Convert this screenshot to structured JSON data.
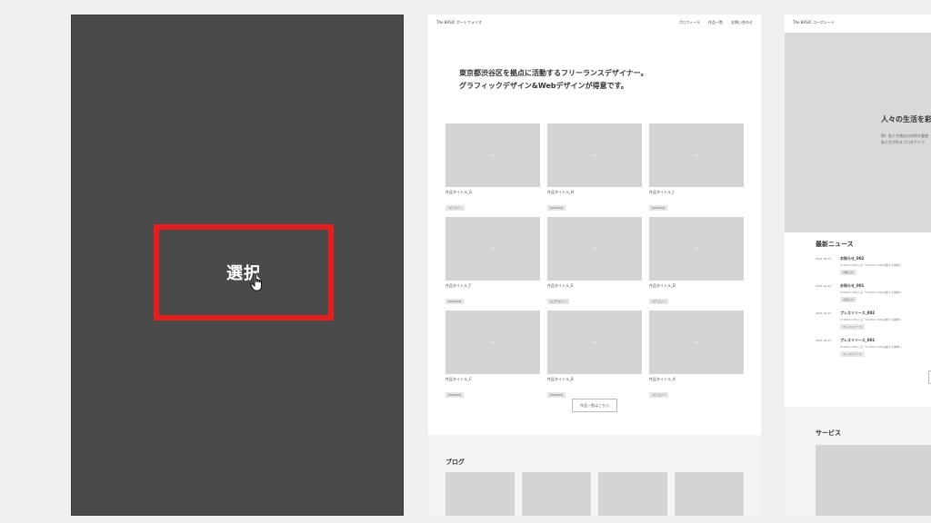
{
  "templates": {
    "selected": {
      "select_label": "選択"
    },
    "portfolio": {
      "brand": "The BASIC ポートフォリオ",
      "nav": [
        "プロフィール",
        "作品一覧",
        "お問い合わせ"
      ],
      "hero_lines": [
        "東京都渋谷区を拠点に活動するフリーランスデザイナー。",
        "グラフィックデザイン&Webデザインが得意です。"
      ],
      "works": [
        {
          "title": "作品タイトル_G",
          "tag": "カテゴリー"
        },
        {
          "title": "作品タイトル_H",
          "tag": "#DESIGN"
        },
        {
          "title": "作品タイトル_I",
          "tag": "#DESIGN"
        },
        {
          "title": "作品タイトル_F",
          "tag": "#DESIGN"
        },
        {
          "title": "作品タイトル_E",
          "tag": "ロゴデザイン"
        },
        {
          "title": "作品タイトル_D",
          "tag": "カテゴリー"
        },
        {
          "title": "作品タイトル_C",
          "tag": "#DESIGN"
        },
        {
          "title": "作品タイトル_B",
          "tag": "#DESIGN"
        },
        {
          "title": "作品タイトル_A",
          "tag": "カテゴリー"
        }
      ],
      "more_label": "作品一覧はこちら",
      "blog_title": "ブログ"
    },
    "corporate": {
      "brand": "The BASIC コーポレート",
      "hero_title": "人々の生活を彩",
      "hero_sub": [
        "例）私たち独自の技術を駆使",
        "私たちが作るプロダクトで、"
      ],
      "news_title": "最新ニュース",
      "news": [
        {
          "date": "2021.04.23",
          "title": "お知らせ_002",
          "desc": "STUDIO CMSとは「STUDIO CMSは誰でも簡単に",
          "tag": "お知らせ"
        },
        {
          "date": "2021.04.23",
          "title": "お知らせ_001",
          "desc": "STUDIO CMSとは「STUDIO CMSは誰でも簡単に",
          "tag": "お知らせ"
        },
        {
          "date": "2021.04.23",
          "title": "プレスリリース_002",
          "desc": "STUDIO CMSとは「STUDIO CMSは誰でも簡単に",
          "tag": "プレスリリース"
        },
        {
          "date": "2021.04.23",
          "title": "プレスリリース_001",
          "desc": "STUDIO CMSとは「STUDIO CMSは誰でも簡単に",
          "tag": "プレスリリース"
        }
      ],
      "service_title": "サービス"
    }
  },
  "colors": {
    "page_bg": "#efefef",
    "selected_card_bg": "#4a4a4a",
    "selection_border": "#e61e1e",
    "placeholder": "#d4d4d4"
  }
}
